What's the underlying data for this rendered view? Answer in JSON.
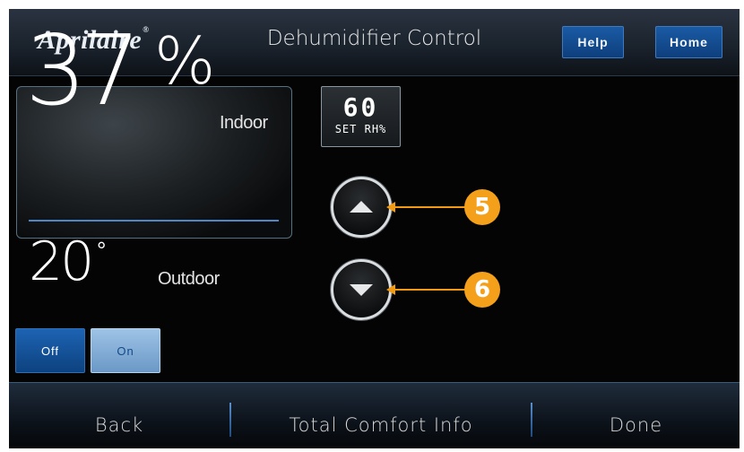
{
  "header": {
    "logo": "Aprilaire",
    "logo_mark": "®",
    "title": "Dehumidifier Control",
    "help_label": "Help",
    "home_label": "Home"
  },
  "reading": {
    "indoor_value": "37",
    "indoor_unit": "%",
    "indoor_label": "Indoor",
    "outdoor_value": "20",
    "outdoor_unit": "°",
    "outdoor_label": "Outdoor"
  },
  "mode": {
    "off_label": "Off",
    "on_label": "On",
    "selected": "On"
  },
  "setpoint": {
    "value": "60",
    "label": "SET RH%"
  },
  "callouts": {
    "up": "5",
    "down": "6"
  },
  "footer": {
    "back_label": "Back",
    "info_label": "Total Comfort Info",
    "done_label": "Done"
  },
  "colors": {
    "accent_blue": "#0e3f7d",
    "callout_orange": "#f5a01a",
    "divider_blue": "#4f87c6"
  }
}
